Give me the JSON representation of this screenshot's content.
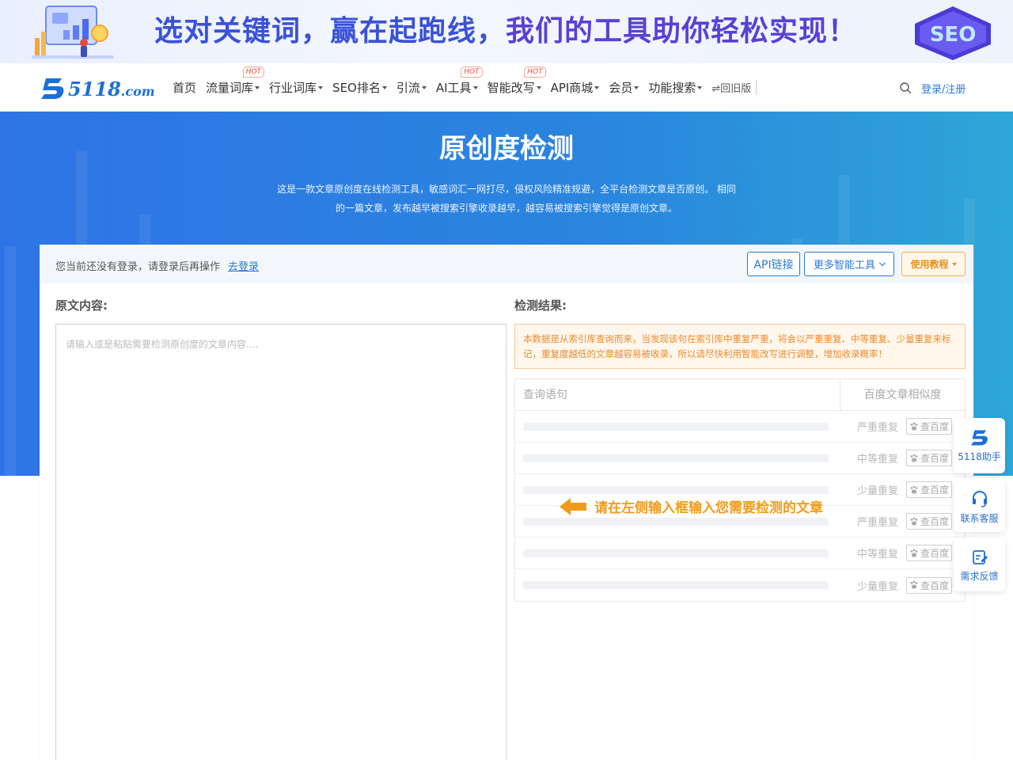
{
  "banner": {
    "slogan_part1": "选对关键词，赢在起跑线，",
    "slogan_part2": "我们的工具助你轻松实现！",
    "seo_label": "SEO"
  },
  "brand": {
    "logo_text": "5118",
    "logo_suffix": ".com",
    "primary_color": "#1b6fd8"
  },
  "nav": {
    "items": [
      {
        "label": "首页",
        "dropdown": false,
        "hot": false
      },
      {
        "label": "流量词库",
        "dropdown": true,
        "hot": true
      },
      {
        "label": "行业词库",
        "dropdown": true,
        "hot": false
      },
      {
        "label": "SEO排名",
        "dropdown": true,
        "hot": false
      },
      {
        "label": "引流",
        "dropdown": true,
        "hot": false
      },
      {
        "label": "AI工具",
        "dropdown": true,
        "hot": true
      },
      {
        "label": "智能改写",
        "dropdown": true,
        "hot": true
      },
      {
        "label": "API商城",
        "dropdown": true,
        "hot": false
      },
      {
        "label": "会员",
        "dropdown": true,
        "hot": false
      },
      {
        "label": "功能搜索",
        "dropdown": true,
        "hot": false
      }
    ],
    "hot_badge": "HOT",
    "old_version": "⇌回旧版",
    "login": "登录/注册"
  },
  "hero": {
    "title": "原创度检测",
    "desc_line1": "这是一款文章原创度在线检测工具，敏感词汇一网打尽，侵权风险精准规避，全平台检测文章是否原创。 相同",
    "desc_line2": "的一篇文章，发布越早被搜索引擎收录越早，越容易被搜索引擎觉得是原创文章。"
  },
  "toolbar": {
    "login_tip": "您当前还没有登录，请登录后再操作",
    "login_link": "去登录",
    "api_button": "API链接",
    "tools_button": "更多智能工具",
    "tutorial_button": "使用教程"
  },
  "editor": {
    "label": "原文内容:",
    "placeholder": "请输入或是粘贴需要检测原创度的文章内容....",
    "value": ""
  },
  "result": {
    "label": "检测结果:",
    "notice": "本数据是从索引库查询而来，当发现该句在索引库中重复严重，将会以严重重复、中等重复、少量重复来标记，重复度越低的文章越容易被收录，所以请尽快利用智能改写进行调整，增加收录概率！",
    "col_query": "查询语句",
    "col_similarity": "百度文章相似度",
    "check_button": "查百度",
    "rows": [
      {
        "level": "严重重复"
      },
      {
        "level": "中等重复"
      },
      {
        "level": "少量重复"
      },
      {
        "level": "严重重复"
      },
      {
        "level": "中等重复"
      },
      {
        "level": "少量重复"
      }
    ],
    "hint": "请在左侧输入框输入您需要检测的文章"
  },
  "float_tools": {
    "assistant": "5118助手",
    "service": "联系客服",
    "feedback": "需求反馈"
  }
}
